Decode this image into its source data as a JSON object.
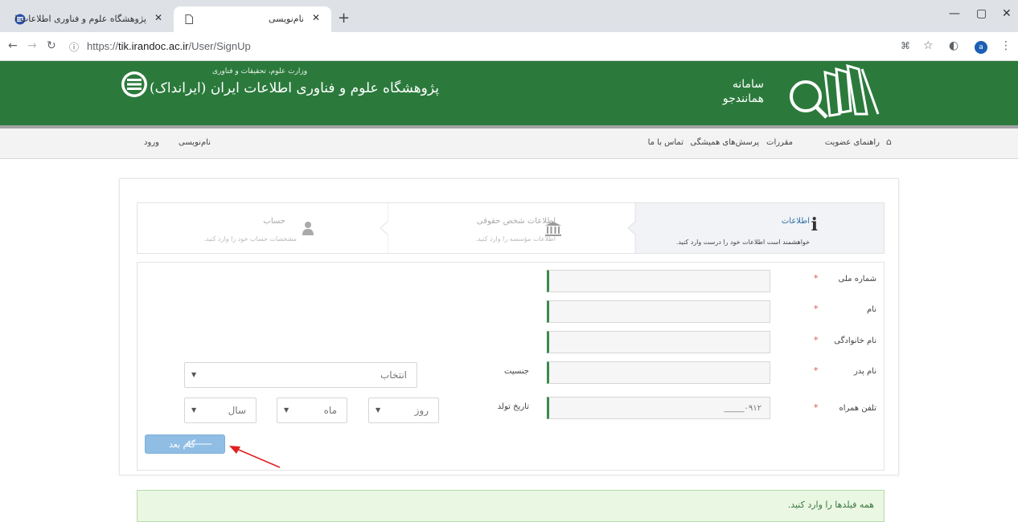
{
  "browser": {
    "tabs": [
      {
        "title": "پژوهشگاه علوم و فناوری اطلاعات ا",
        "active": false
      },
      {
        "title": "نام‌نویسی",
        "active": true
      }
    ],
    "url": {
      "scheme": "https://",
      "host": "tik.irandoc.ac.ir",
      "path": "/User/SignUp"
    },
    "profile_initial": "a"
  },
  "header": {
    "ministry": "وزارت علوم، تحقیقات و فناوری",
    "institute": "پژوهشگاه علوم و فناوری اطلاعات ایران (ایرانداک)",
    "system_title_1": "سامانه",
    "system_title_2": "همانندجو",
    "brand_color": "#2b7a3c"
  },
  "nav": {
    "right": [
      "راهنمای عضویت",
      "مقررات",
      "پرسش‌های همیشگی",
      "تماس با ما"
    ],
    "left": [
      "نام‌نویسی",
      "ورود"
    ]
  },
  "steps": [
    {
      "title": "اطلاعات",
      "desc": "خواهشمند است اطلاعات خود را درست وارد کنید.",
      "icon": "info-icon",
      "active": true
    },
    {
      "title": "اطلاعات شخص حقوقی",
      "desc": "اطلاعات مؤسسه را وارد کنید.",
      "icon": "institution-icon",
      "active": false
    },
    {
      "title": "حساب",
      "desc": "مشخصات حساب خود را وارد کنید.",
      "icon": "user-icon",
      "active": false
    }
  ],
  "form": {
    "labels": {
      "national_id": "شماره ملی",
      "first_name": "نام",
      "last_name": "نام خانوادگی",
      "father_name": "نام پدر",
      "mobile": "تلفن همراه",
      "gender": "جنسیت",
      "birth_date": "تاریخ تولد"
    },
    "required_mark": "*",
    "mobile_placeholder": "۰۹۱۲_____",
    "gender_value": "انتخاب",
    "birth": {
      "day": "روز",
      "month": "ماه",
      "year": "سال"
    },
    "next_button": "گام بعد"
  },
  "alert": "همه فیلدها را وارد کنید."
}
